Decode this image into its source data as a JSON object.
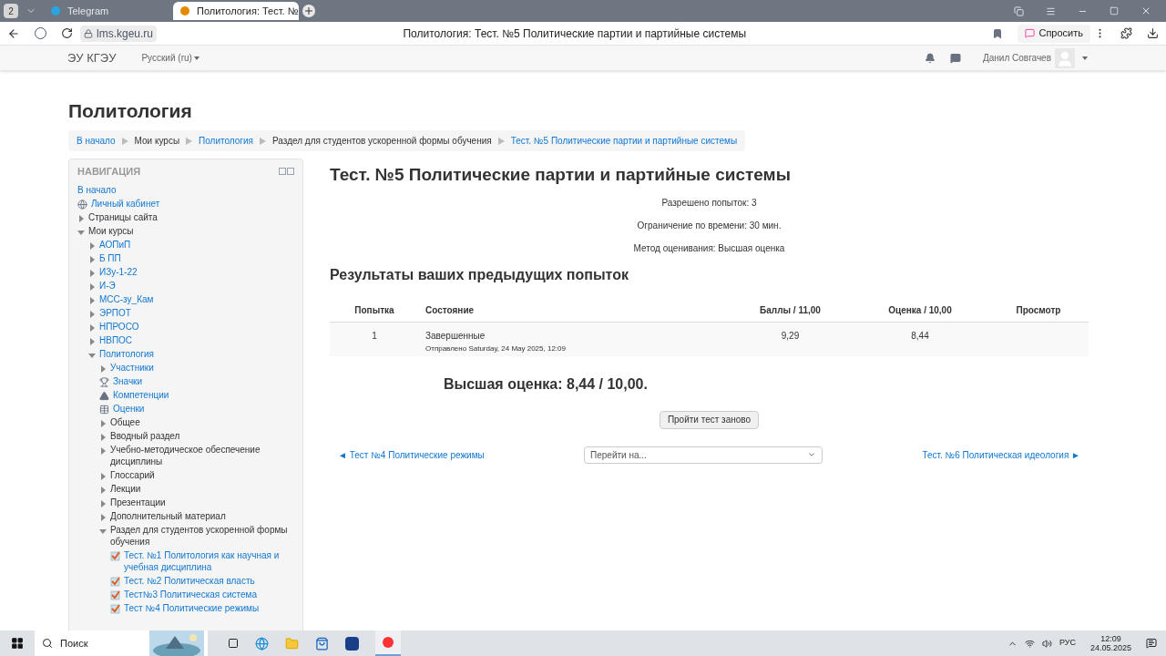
{
  "browser": {
    "tab_count": "2",
    "tabs": [
      {
        "title": "Telegram",
        "selected": false
      },
      {
        "title": "Политология: Тест. №",
        "selected": true
      }
    ],
    "url": "lms.kgeu.ru",
    "page_title": "Политология: Тест. №5 Политические партии и партийные системы",
    "ask_button": "Спросить"
  },
  "header": {
    "site_name": "ЭУ КГЭУ",
    "language": "Русский (ru)",
    "user_name": "Данил Совгачев"
  },
  "page_heading": "Политология",
  "breadcrumbs": [
    {
      "label": "В начало",
      "link": true
    },
    {
      "label": "Мои курсы",
      "link": false
    },
    {
      "label": "Политология",
      "link": true
    },
    {
      "label": "Раздел для студентов ускоренной формы обучения",
      "link": false
    },
    {
      "label": "Тест. №5 Политические партии и партийные системы",
      "link": true
    }
  ],
  "navigation": {
    "title": "НАВИГАЦИЯ",
    "items": [
      {
        "label": "В начало",
        "link": true,
        "kind": "plain"
      },
      {
        "label": "Личный кабинет",
        "link": true,
        "kind": "profile"
      },
      {
        "label": "Страницы сайта",
        "link": false,
        "kind": "caret",
        "expanded": false
      },
      {
        "label": "Мои курсы",
        "link": false,
        "kind": "caret",
        "expanded": true,
        "children": [
          {
            "label": "АОПиП",
            "link": true,
            "kind": "caret",
            "expanded": false
          },
          {
            "label": "Б ПП",
            "link": true,
            "kind": "caret",
            "expanded": false
          },
          {
            "label": "ИЗу-1-22",
            "link": true,
            "kind": "caret",
            "expanded": false
          },
          {
            "label": "И-Э",
            "link": true,
            "kind": "caret",
            "expanded": false
          },
          {
            "label": "МСС-зу_Кам",
            "link": true,
            "kind": "caret",
            "expanded": false
          },
          {
            "label": "ЭРПОТ",
            "link": true,
            "kind": "caret",
            "expanded": false
          },
          {
            "label": "НПРОСО",
            "link": true,
            "kind": "caret",
            "expanded": false
          },
          {
            "label": "НВПОС",
            "link": true,
            "kind": "caret",
            "expanded": false
          },
          {
            "label": "Политология",
            "link": true,
            "kind": "caret",
            "expanded": true,
            "children": [
              {
                "label": "Участники",
                "link": true,
                "kind": "caret",
                "expanded": false
              },
              {
                "label": "Значки",
                "link": true,
                "kind": "trophy"
              },
              {
                "label": "Компетенции",
                "link": true,
                "kind": "competency"
              },
              {
                "label": "Оценки",
                "link": true,
                "kind": "grades"
              },
              {
                "label": "Общее",
                "link": false,
                "kind": "caret",
                "expanded": false
              },
              {
                "label": "Вводный раздел",
                "link": false,
                "kind": "caret",
                "expanded": false
              },
              {
                "label": "Учебно-методическое обеспечение дисциплины",
                "link": false,
                "kind": "caret",
                "expanded": false
              },
              {
                "label": "Глоссарий",
                "link": false,
                "kind": "caret",
                "expanded": false
              },
              {
                "label": "Лекции",
                "link": false,
                "kind": "caret",
                "expanded": false
              },
              {
                "label": "Презентации",
                "link": false,
                "kind": "caret",
                "expanded": false
              },
              {
                "label": "Дополнительный материал",
                "link": false,
                "kind": "caret",
                "expanded": false
              },
              {
                "label": "Раздел для студентов ускоренной формы обучения",
                "link": false,
                "kind": "caret",
                "expanded": true,
                "children": [
                  {
                    "label": "Тест. №1 Политология как научная и учебная дисциплина",
                    "link": true,
                    "kind": "quiz"
                  },
                  {
                    "label": "Тест. №2 Политическая власть",
                    "link": true,
                    "kind": "quiz"
                  },
                  {
                    "label": "Тест№3 Политическая система",
                    "link": true,
                    "kind": "quiz"
                  },
                  {
                    "label": "Тест №4 Политические режимы",
                    "link": true,
                    "kind": "quiz"
                  }
                ]
              }
            ]
          }
        ]
      }
    ]
  },
  "quiz": {
    "title": "Тест. №5 Политические партии и партийные системы",
    "info": [
      "Разрешено попыток: 3",
      "Ограничение по времени: 30 мин.",
      "Метод оценивания: Высшая оценка"
    ],
    "results_heading": "Результаты ваших предыдущих попыток",
    "table": {
      "columns": [
        "Попытка",
        "Состояние",
        "Баллы / 11,00",
        "Оценка / 10,00",
        "Просмотр"
      ],
      "rows": [
        {
          "attempt": "1",
          "state": "Завершенные",
          "submitted": "Отправлено Saturday, 24 May 2025, 12:09",
          "points": "9,29",
          "grade": "8,44"
        }
      ]
    },
    "highest_grade": "Высшая оценка: 8,44 / 10,00.",
    "retry_button": "Пройти тест заново",
    "prev_link": "◄ Тест №4 Политические режимы",
    "jump_placeholder": "Перейти на...",
    "next_link": "Тест. №6 Политическая идеология ►"
  },
  "taskbar": {
    "search_placeholder": "Поиск",
    "language": "РУС",
    "time": "12:09",
    "date": "24.05.2025"
  }
}
